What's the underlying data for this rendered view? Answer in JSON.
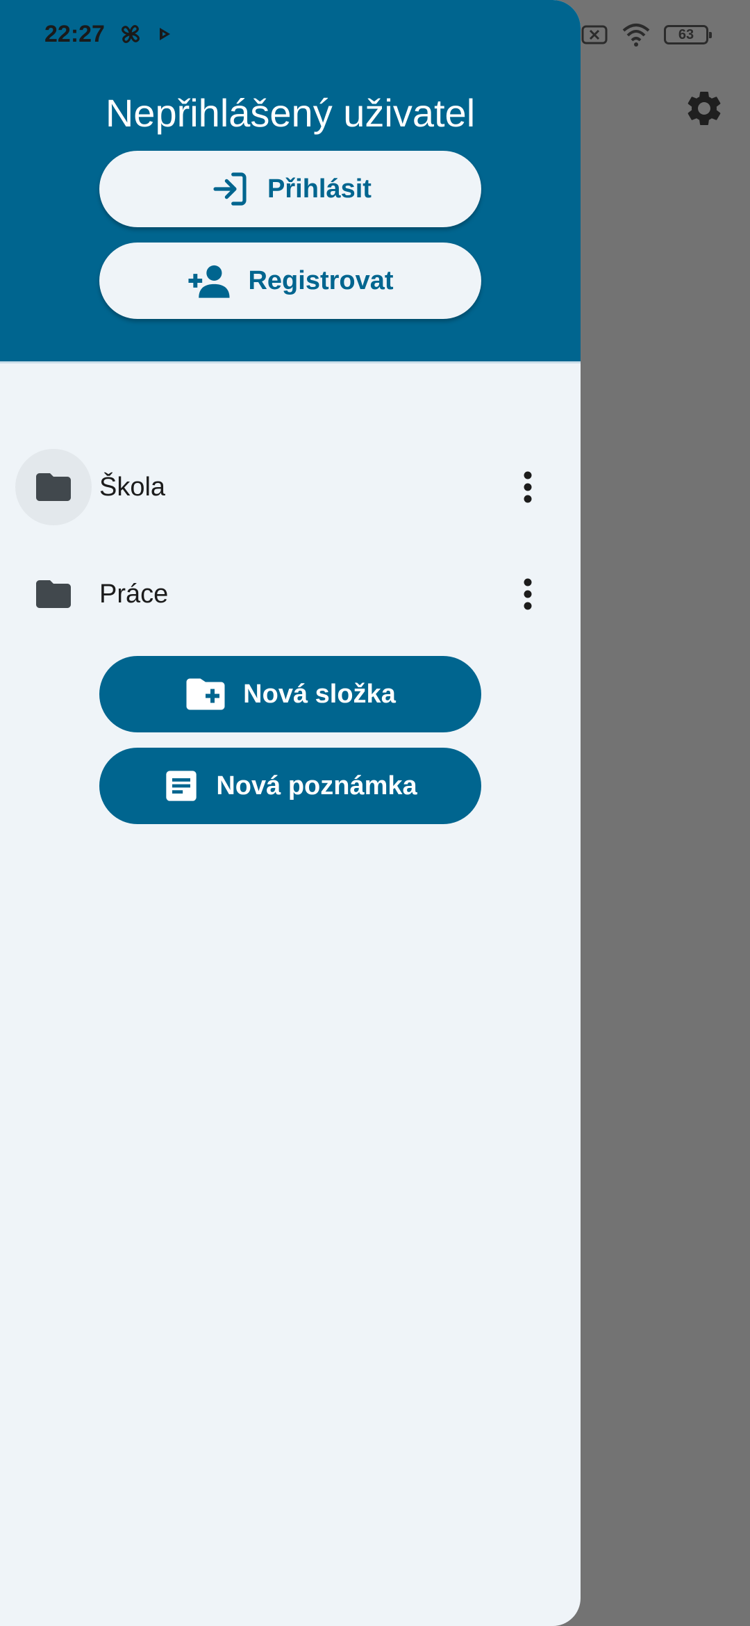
{
  "status_bar": {
    "time": "22:27",
    "battery": "63"
  },
  "drawer": {
    "header": {
      "title": "Nepřihlášený uživatel",
      "login_label": "Přihlásit",
      "register_label": "Registrovat"
    },
    "folders": [
      {
        "name": "Škola",
        "icon": "folder-icon",
        "highlighted": true
      },
      {
        "name": "Práce",
        "icon": "folder-icon",
        "highlighted": false
      }
    ],
    "actions": {
      "new_folder_label": "Nová složka",
      "new_note_label": "Nová poznámka"
    }
  },
  "background": {
    "settings_icon": "gear-icon"
  },
  "colors": {
    "primary": "#00658f",
    "drawer_surface": "#eff4f8",
    "scrim": "#737373",
    "on_surface": "#1c1c1c",
    "folder_icon": "#41484d"
  }
}
